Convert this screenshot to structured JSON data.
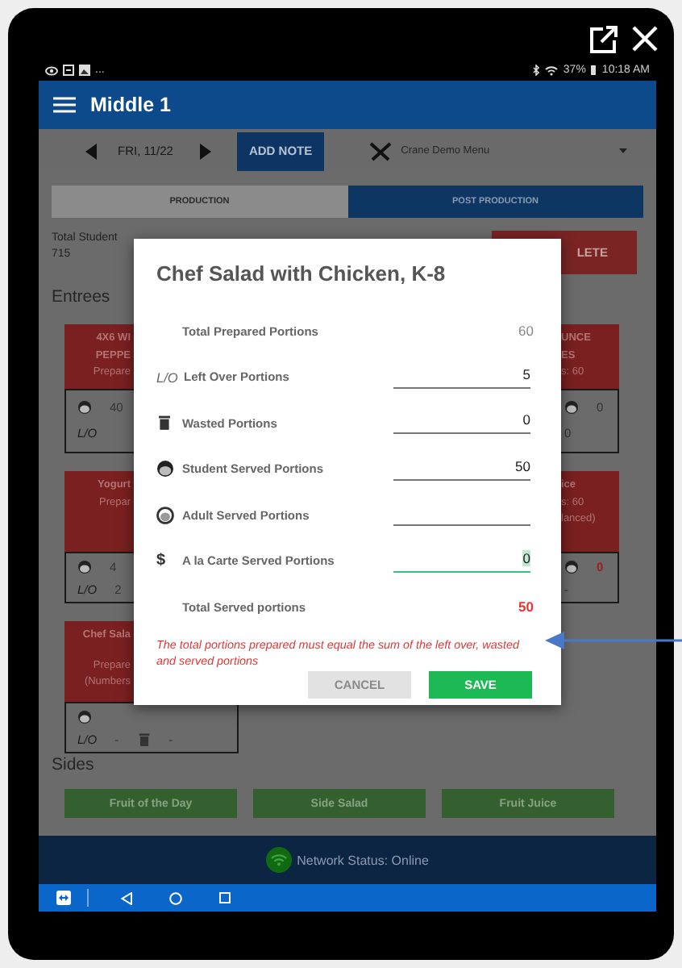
{
  "status_bar": {
    "overflow": "...",
    "battery": "37%",
    "time": "10:18 AM"
  },
  "app_bar": {
    "title": "Middle 1"
  },
  "toolbar": {
    "date": "FRI, 11/22",
    "add_note": "ADD NOTE",
    "menu": "Crane Demo Menu"
  },
  "tabs": [
    {
      "label": "PRODUCTION",
      "selected": false
    },
    {
      "label": "POST PRODUCTION",
      "selected": true
    }
  ],
  "feeding": {
    "label": "Total Student",
    "value": "715",
    "complete_button": "LETE"
  },
  "entrees": {
    "title": "Entrees",
    "left": [
      {
        "lines": [
          {
            "kind": "title",
            "text": "4X6 WI"
          },
          {
            "kind": "title",
            "text": "PEPPE"
          },
          {
            "kind": "detail",
            "text": "Prepare"
          }
        ],
        "stats": [
          [
            {
              "kind": "student"
            },
            {
              "kind": "value",
              "text": "40",
              "alert": false
            }
          ],
          [
            {
              "kind": "label",
              "text": "L/O"
            }
          ]
        ]
      },
      {
        "lines": [
          {
            "kind": "title",
            "text": "Yogurt"
          },
          {
            "kind": "detail",
            "text": "Prepar"
          }
        ],
        "stats": [
          [
            {
              "kind": "student"
            },
            {
              "kind": "value",
              "text": "4",
              "alert": false
            }
          ],
          [
            {
              "kind": "label",
              "text": "L/O"
            },
            {
              "kind": "value",
              "text": "2",
              "alert": false
            }
          ]
        ]
      },
      {
        "lines": [
          {
            "kind": "title",
            "text": "Chef Sala"
          },
          {
            "kind": "detail",
            "text": "Prepare"
          },
          {
            "kind": "detail",
            "text": "(Numbers"
          }
        ],
        "stats": [
          [
            {
              "kind": "student"
            }
          ],
          [
            {
              "kind": "label",
              "text": "L/O"
            },
            {
              "kind": "value",
              "text": "-",
              "alert": false
            },
            {
              "kind": "trash"
            },
            {
              "kind": "value",
              "text": "-",
              "alert": false
            }
          ]
        ]
      }
    ],
    "right": [
      {
        "lines": [
          {
            "kind": "title",
            "text": "UNCE"
          },
          {
            "kind": "title",
            "text": "ES"
          },
          {
            "kind": "detail",
            "text": "s: 60"
          }
        ],
        "stats": [
          [
            {
              "kind": "student"
            },
            {
              "kind": "value",
              "text": "0",
              "alert": false
            }
          ],
          [
            {
              "kind": "value",
              "text": "0",
              "alert": false
            }
          ]
        ]
      },
      {
        "lines": [
          {
            "kind": "title",
            "text": "ice"
          },
          {
            "kind": "detail",
            "text": "s: 60"
          },
          {
            "kind": "detail",
            "text": "lanced)"
          }
        ],
        "stats": [
          [
            {
              "kind": "student"
            },
            {
              "kind": "value",
              "text": "0",
              "alert": true
            }
          ],
          [
            {
              "kind": "value",
              "text": "-",
              "alert": false
            }
          ]
        ]
      }
    ]
  },
  "sides": {
    "title": "Sides",
    "items": [
      "Fruit of the Day",
      "Side Salad",
      "Fruit Juice"
    ]
  },
  "network": {
    "status": "Network Status: Online"
  },
  "dialog": {
    "title": "Chef Salad with Chicken, K-8",
    "rows": [
      {
        "kind": "total",
        "label": "Total Prepared Portions",
        "value": "60",
        "alert": false
      },
      {
        "kind": "field",
        "prefix": "L/O",
        "label": "Left Over Portions",
        "value": "5",
        "focused": false
      },
      {
        "kind": "trash",
        "label": "Wasted Portions",
        "value": "0",
        "focused": false
      },
      {
        "kind": "student",
        "label": "Student Served Portions",
        "value": "50",
        "focused": false
      },
      {
        "kind": "adult",
        "label": "Adult Served Portions",
        "focused": false
      },
      {
        "kind": "field",
        "prefix": "$",
        "label": "A la Carte Served Portions",
        "value": "0",
        "focused": true
      },
      {
        "kind": "total",
        "label": "Total Served portions",
        "value": "50",
        "alert": true
      }
    ],
    "error": "The total portions prepared must equal the sum of the left over, wasted and served portions",
    "buttons": [
      {
        "label": "CANCEL",
        "disabled": true
      },
      {
        "label": "SAVE",
        "disabled": false
      }
    ]
  }
}
